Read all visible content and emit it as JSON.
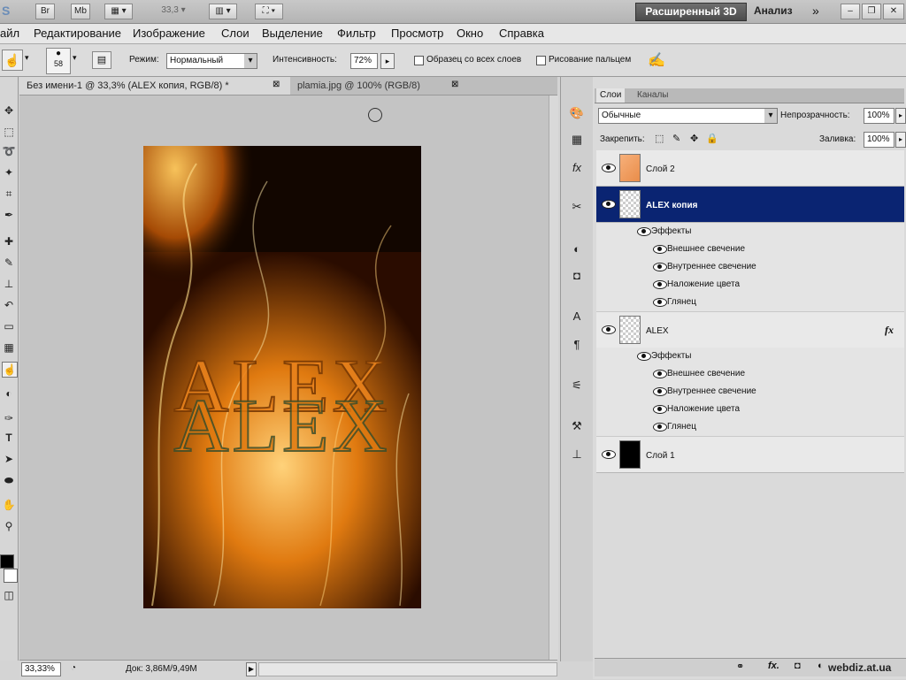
{
  "appbar": {
    "ps_mark": "S",
    "br_label": "Br",
    "mb_label": "Mb",
    "zoom": "33,3",
    "workspace_active": "Расширенный 3D",
    "workspace_next": "Анализ"
  },
  "menu": [
    "айл",
    "Редактирование",
    "Изображение",
    "Слои",
    "Выделение",
    "Фильтр",
    "Просмотр",
    "Окно",
    "Справка"
  ],
  "options": {
    "brush_size": "58",
    "mode_label": "Режим:",
    "mode_value": "Нормальный",
    "intensity_label": "Интенсивность:",
    "intensity_value": "72%",
    "sample_all_label": "Образец со всех слоев",
    "finger_label": "Рисование пальцем"
  },
  "tabs": [
    {
      "label": "Без имени-1 @ 33,3% (ALEX копия, RGB/8) *"
    },
    {
      "label": "plamia.jpg @ 100% (RGB/8)"
    }
  ],
  "canvas": {
    "text": "ALEX"
  },
  "status": {
    "zoom": "33,33%",
    "doc": "Док: 3,86M/9,49M"
  },
  "panel": {
    "tab_layers": "Слои",
    "tab_channels": "Каналы",
    "blend": "Обычные",
    "opacity_label": "Непрозрачность:",
    "opacity": "100%",
    "lock_label": "Закрепить:",
    "fill_label": "Заливка:",
    "fill": "100%",
    "layers": [
      {
        "name": "Слой 2",
        "effects": []
      },
      {
        "name": "ALEX копия",
        "selected": true,
        "effects_label": "Эффекты",
        "effects": [
          "Внешнее свечение",
          "Внутреннее свечение",
          "Наложение цвета",
          "Глянец"
        ]
      },
      {
        "name": "ALEX",
        "effects_label": "Эффекты",
        "effects": [
          "Внешнее свечение",
          "Внутреннее свечение",
          "Наложение цвета",
          "Глянец"
        ]
      },
      {
        "name": "Слой 1",
        "effects": []
      }
    ],
    "fx_badge": "fx"
  },
  "watermark": "webdiz.at.ua",
  "colors": {
    "selected": "#0a2472",
    "fire": "#e07a10"
  }
}
